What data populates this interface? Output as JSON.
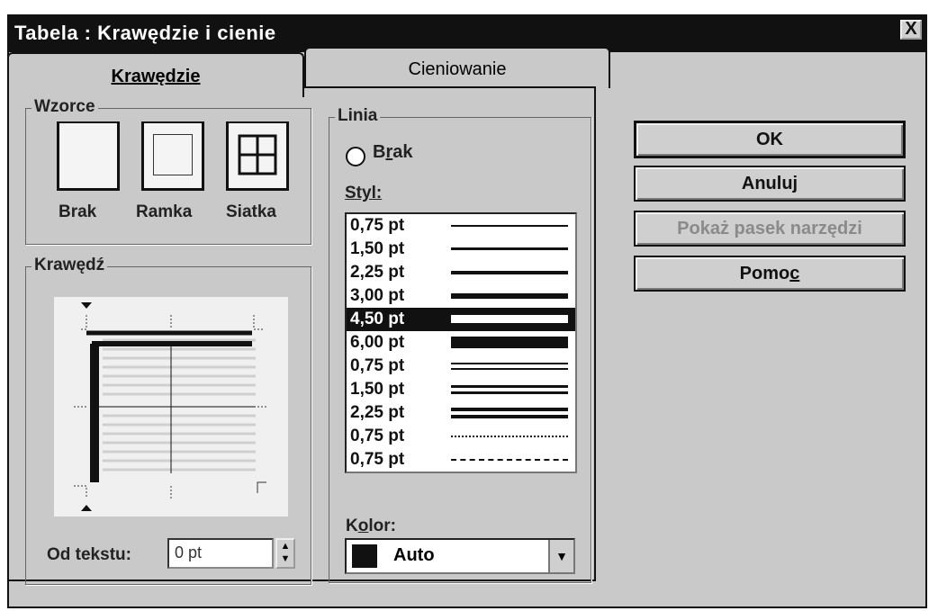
{
  "dialog": {
    "title": "Tabela : Krawędzie i cienie",
    "close_symbol": "X"
  },
  "tabs": [
    {
      "label": "Krawędzie"
    },
    {
      "label": "Cieniowanie"
    }
  ],
  "wzorce": {
    "label": "Wzorce",
    "presets": [
      {
        "label": "Brak"
      },
      {
        "label": "Ramka"
      },
      {
        "label": "Siatka"
      }
    ]
  },
  "krawedz": {
    "label": "Krawędź",
    "od_tekstu_label": "Od tekstu:",
    "od_tekstu_value": "0 pt"
  },
  "linia": {
    "label": "Linia",
    "radio_brak": "Brak",
    "styl_label": "Styl:",
    "styles": [
      {
        "label": "0,75 pt",
        "kind": "single"
      },
      {
        "label": "1,50 pt",
        "kind": "single"
      },
      {
        "label": "2,25 pt",
        "kind": "single"
      },
      {
        "label": "3,00 pt",
        "kind": "single"
      },
      {
        "label": "4,50 pt",
        "kind": "single"
      },
      {
        "label": "6,00 pt",
        "kind": "single"
      },
      {
        "label": "0,75 pt",
        "kind": "double"
      },
      {
        "label": "1,50 pt",
        "kind": "double"
      },
      {
        "label": "2,25 pt",
        "kind": "double"
      },
      {
        "label": "0,75 pt",
        "kind": "dotted"
      },
      {
        "label": "0,75 pt",
        "kind": "dashed"
      }
    ],
    "selected_style_index": 4,
    "kolor_label": "Kolor:",
    "kolor_value": "Auto"
  },
  "buttons": {
    "ok": "OK",
    "anuluj": "Anuluj",
    "pokaz": "Pokaż pasek narzędzi",
    "pomoc": "Pomoc"
  }
}
